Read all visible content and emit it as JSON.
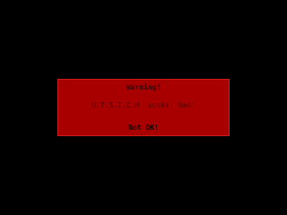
{
  "colors": {
    "background": "#000000",
    "dialog_background": "#a80000",
    "dialog_border": "#c81a1a",
    "text": "#3a0000"
  },
  "dialog": {
    "title": "Warning!",
    "message": "U.T.S.I.C.H. sucks! Bad!",
    "button_label": "Not OK!"
  }
}
